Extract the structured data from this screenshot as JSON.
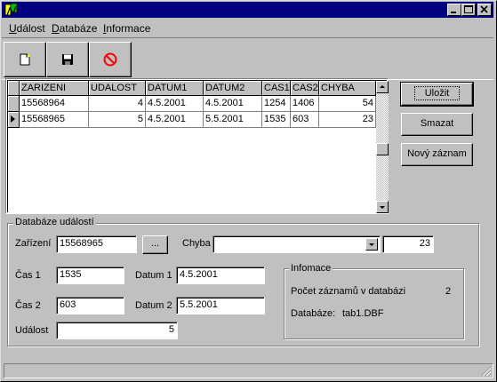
{
  "window": {
    "title": "",
    "colors": {
      "titlebar": "#000080",
      "face": "#c0c0c0"
    }
  },
  "menu": {
    "items": [
      "Událost",
      "Databáze",
      "Informace"
    ]
  },
  "toolbar": {
    "buttons": [
      "new-document-icon",
      "save-icon",
      "cancel-icon"
    ]
  },
  "grid": {
    "columns": [
      "ZARIZENI",
      "UDALOST",
      "DATUM1",
      "DATUM2",
      "CAS1",
      "CAS2",
      "CHYBA"
    ],
    "rows": [
      [
        "15568964",
        "4",
        "4.5.2001",
        "4.5.2001",
        "1254",
        "1406",
        "54"
      ],
      [
        "15568965",
        "5",
        "4.5.2001",
        "5.5.2001",
        "1535",
        "603",
        "23"
      ]
    ],
    "current_row": 1
  },
  "actions": {
    "save": "Uložit",
    "delete": "Smazat",
    "new_record": "Nový záznam"
  },
  "events_group": {
    "title": "Databáze událostí",
    "device_label": "Zařízení",
    "device_value": "15568965",
    "browse_label": "...",
    "error_label": "Chyba",
    "error_select_value": "",
    "error_value": "23",
    "time1_label": "Čas 1",
    "time1_value": "1535",
    "time2_label": "Čas 2",
    "time2_value": "603",
    "date1_label": "Datum 1",
    "date1_value": "4.5.2001",
    "date2_label": "Datum 2",
    "date2_value": "5.5.2001",
    "event_label": "Událost",
    "event_value": "5"
  },
  "info_group": {
    "title": "Infomace",
    "count_label": "Počet záznamů v databázi",
    "count_value": "2",
    "db_label": "Databáze:",
    "db_value": "tab1.DBF"
  }
}
